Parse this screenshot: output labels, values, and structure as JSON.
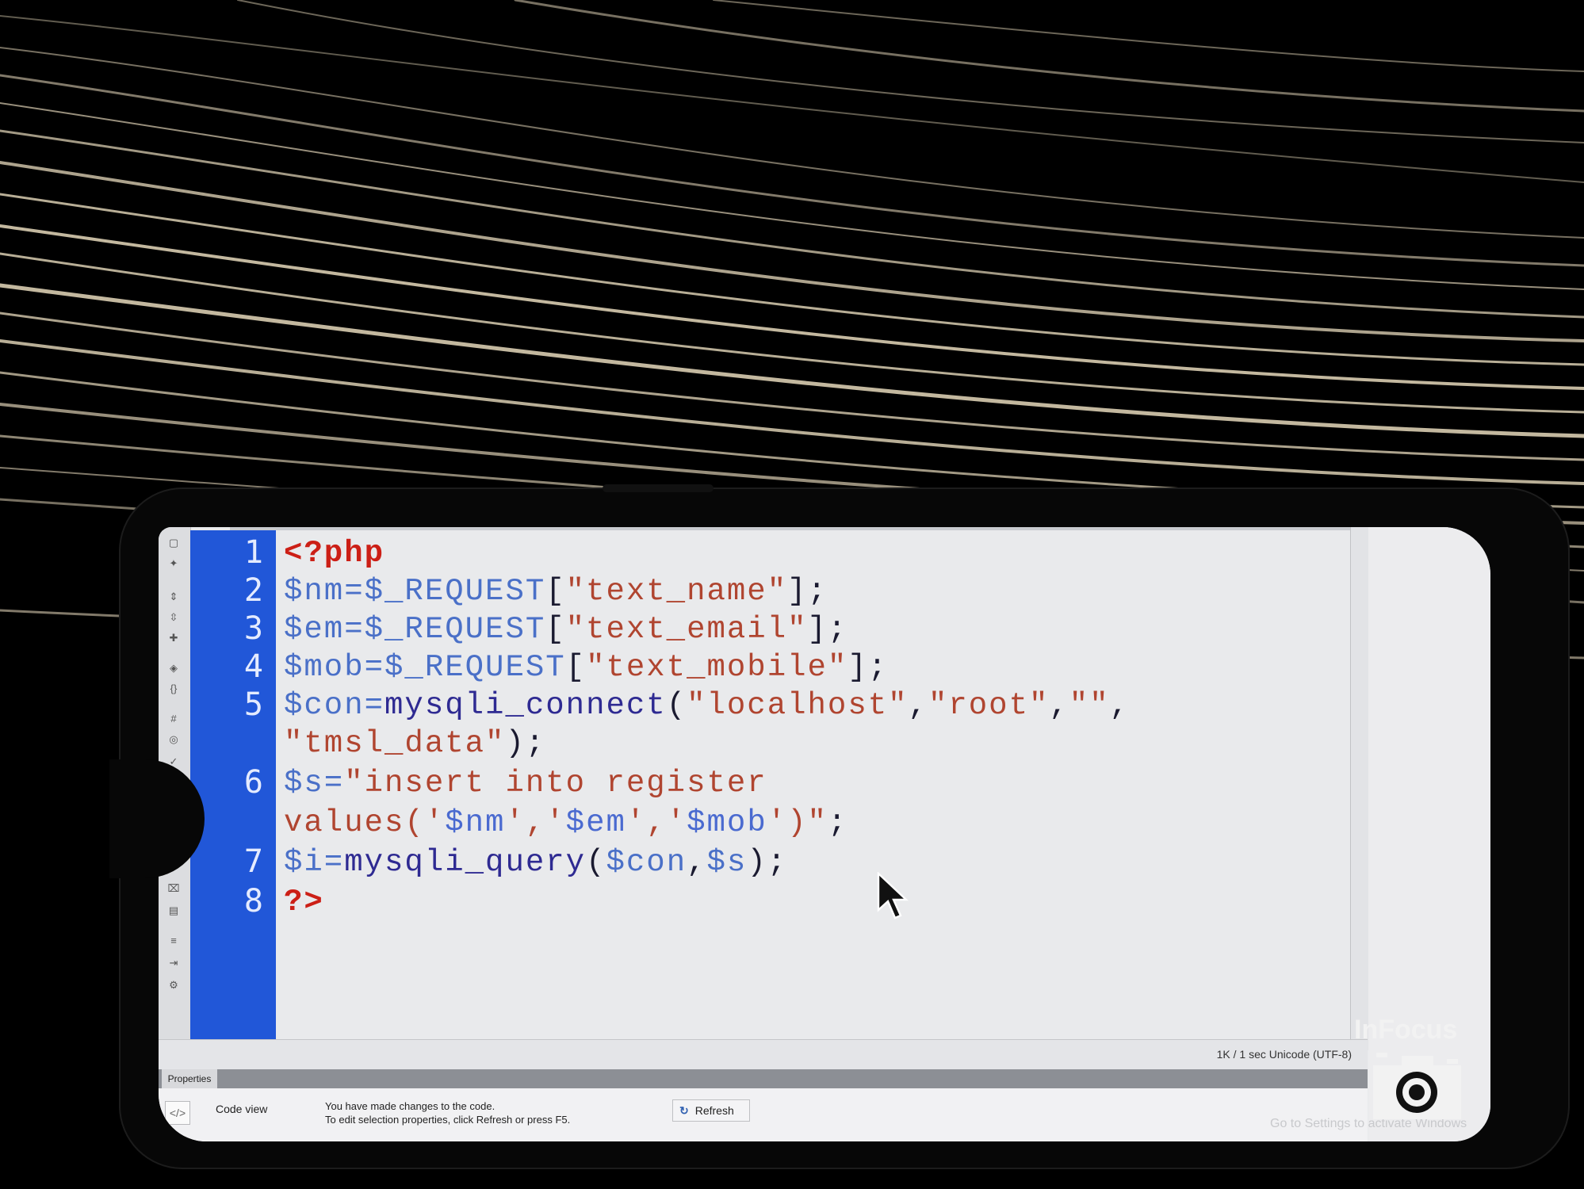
{
  "editor": {
    "line_numbers": [
      "1",
      "2",
      "3",
      "4",
      "5",
      "6",
      "7",
      "8"
    ],
    "code_lines": [
      [
        {
          "t": "<?php",
          "c": "php"
        }
      ],
      [
        {
          "t": "$nm=$_REQUEST",
          "c": "var"
        },
        {
          "t": "[",
          "c": "pun"
        },
        {
          "t": "\"text_name\"",
          "c": "str"
        },
        {
          "t": "];",
          "c": "pun"
        }
      ],
      [
        {
          "t": "$em=$_REQUEST",
          "c": "var"
        },
        {
          "t": "[",
          "c": "pun"
        },
        {
          "t": "\"text_email\"",
          "c": "str"
        },
        {
          "t": "];",
          "c": "pun"
        }
      ],
      [
        {
          "t": "$mob=$_REQUEST",
          "c": "var"
        },
        {
          "t": "[",
          "c": "pun"
        },
        {
          "t": "\"text_mobile\"",
          "c": "str"
        },
        {
          "t": "];",
          "c": "pun"
        }
      ],
      [
        {
          "t": "$con=",
          "c": "var"
        },
        {
          "t": "mysqli_connect",
          "c": "fn"
        },
        {
          "t": "(",
          "c": "pun"
        },
        {
          "t": "\"localhost\"",
          "c": "str"
        },
        {
          "t": ",",
          "c": "pun"
        },
        {
          "t": "\"root\"",
          "c": "str"
        },
        {
          "t": ",",
          "c": "pun"
        },
        {
          "t": "\"\"",
          "c": "str"
        },
        {
          "t": ",",
          "c": "pun"
        }
      ],
      [
        {
          "t": "\"tmsl_data\"",
          "c": "str"
        },
        {
          "t": ");",
          "c": "pun"
        }
      ],
      [
        {
          "t": "$s=",
          "c": "var"
        },
        {
          "t": "\"insert into register",
          "c": "str"
        }
      ],
      [
        {
          "t": "values('",
          "c": "str"
        },
        {
          "t": "$nm",
          "c": "vstr"
        },
        {
          "t": "','",
          "c": "str"
        },
        {
          "t": "$em",
          "c": "vstr"
        },
        {
          "t": "','",
          "c": "str"
        },
        {
          "t": "$mob",
          "c": "vstr"
        },
        {
          "t": "')\"",
          "c": "str"
        },
        {
          "t": ";",
          "c": "pun"
        }
      ],
      [
        {
          "t": "$i=",
          "c": "var"
        },
        {
          "t": "mysqli_query",
          "c": "fn"
        },
        {
          "t": "(",
          "c": "pun"
        },
        {
          "t": "$con",
          "c": "var"
        },
        {
          "t": ",",
          "c": "pun"
        },
        {
          "t": "$s",
          "c": "var"
        },
        {
          "t": ");",
          "c": "pun"
        }
      ],
      [
        {
          "t": "?>",
          "c": "php"
        }
      ]
    ]
  },
  "status_bar": {
    "text": "1K / 1 sec  Unicode (UTF-8)"
  },
  "properties": {
    "tab_label": "Properties",
    "code_view_label": "Code view",
    "message_line1": "You have made changes to the code.",
    "message_line2": "To edit selection properties, click Refresh or press F5.",
    "refresh_label": "Refresh",
    "activate_windows_hint": "Go to Settings to activate Windows"
  },
  "watermark": {
    "brand": "InFocus"
  },
  "colors": {
    "gutter": "#2157d8",
    "php_tag": "#cc1f16",
    "variable": "#4a70c8",
    "function": "#2e2a92",
    "string": "#b04530",
    "editor_bg": "#e9eaec"
  }
}
